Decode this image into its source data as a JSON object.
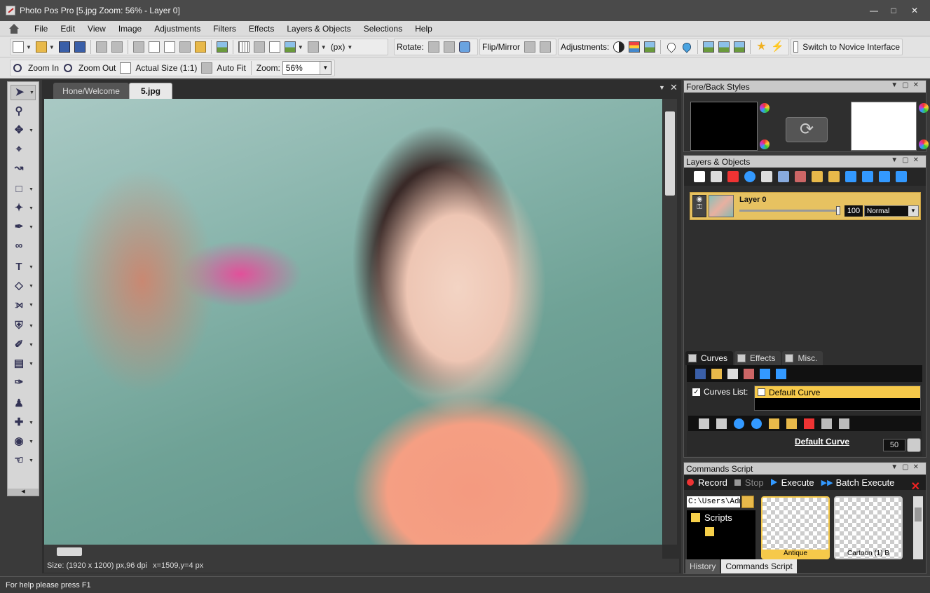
{
  "window": {
    "title": "Photo Pos Pro [5.jpg Zoom: 56% - Layer 0]",
    "icon": "app-logo-icon"
  },
  "menu": [
    "File",
    "Edit",
    "View",
    "Image",
    "Adjustments",
    "Filters",
    "Effects",
    "Layers & Objects",
    "Selections",
    "Help"
  ],
  "toolbar1": {
    "units": "(px)",
    "rotate_label": "Rotate:",
    "flip_label": "Flip/Mirror",
    "adjustments_label": "Adjustments:",
    "novice_label": "Switch to Novice Interface"
  },
  "toolbar2": {
    "zoom_in": "Zoom In",
    "zoom_out": "Zoom Out",
    "actual_size": "Actual Size (1:1)",
    "auto_fit": "Auto Fit",
    "zoom_label": "Zoom:",
    "zoom_value": "56%"
  },
  "tools": [
    "select-tool",
    "zoom-tool",
    "move-tool",
    "crop-tool",
    "straighten-tool",
    "marquee-tool",
    "magic-wand-tool",
    "pen-tool",
    "lasso-tool",
    "text-tool",
    "shape-tool",
    "line-tool",
    "fill-tool",
    "brush-tool",
    "eraser-tool",
    "eyedropper-tool",
    "stamp-tool",
    "healing-tool",
    "redeye-tool",
    "smudge-tool"
  ],
  "doc": {
    "tabs": [
      "Hone/Welcome",
      "5.jpg"
    ],
    "status_size": "Size: (1920 x 1200) px,96 dpi",
    "status_coords": "x=1509,y=4 px"
  },
  "panels": {
    "fore_back": {
      "title": "Fore/Back Styles",
      "fore_color": "#000000",
      "back_color": "#ffffff"
    },
    "layers": {
      "title": "Layers & Objects",
      "layer_name": "Layer 0",
      "opacity": "100",
      "blend_mode": "Normal"
    },
    "subtabs": [
      "Curves",
      "Effects",
      "Misc."
    ],
    "curves": {
      "list_label": "Curves List:",
      "selected_curve": "Default Curve",
      "curve_link": "Default Curve",
      "value": "50"
    },
    "commands": {
      "title": "Commands Script",
      "record": "Record",
      "stop": "Stop",
      "execute": "Execute",
      "batch_execute": "Batch Execute",
      "path": "C:\\Users\\Adm",
      "folder": "Scripts",
      "thumb1_caption": "Antique",
      "thumb2_caption": "Cartoon (1) B",
      "bottom_tabs": [
        "History",
        "Commands Script"
      ]
    }
  },
  "statusbar": {
    "help": "For help please press F1"
  }
}
